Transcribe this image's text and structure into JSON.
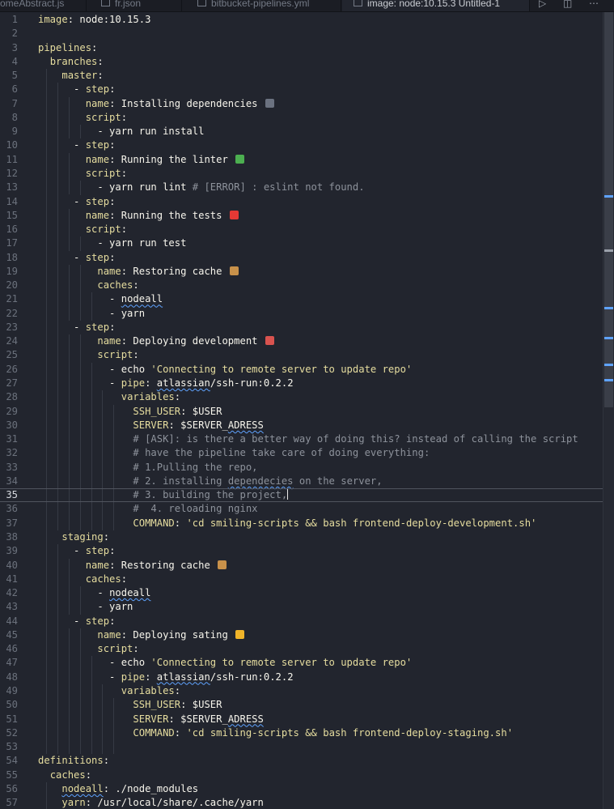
{
  "tabs": [
    {
      "label": "omeAbstract.js",
      "active": false
    },
    {
      "label": "fr.json",
      "active": false
    },
    {
      "label": "bitbucket-pipelines.yml",
      "active": false
    },
    {
      "label": "image: node:10.15.3 Untitled-1",
      "active": true
    }
  ],
  "lines": [
    {
      "n": "1",
      "segs": [
        {
          "t": "image",
          "c": "k"
        },
        {
          "t": ": node:10.15.3",
          "c": "v"
        }
      ]
    },
    {
      "n": "2",
      "segs": []
    },
    {
      "n": "3",
      "segs": [
        {
          "t": "pipelines",
          "c": "k"
        },
        {
          "t": ":",
          "c": "v"
        }
      ]
    },
    {
      "n": "4",
      "segs": [
        {
          "t": "  "
        },
        {
          "t": "branches",
          "c": "k"
        },
        {
          "t": ":",
          "c": "v"
        }
      ]
    },
    {
      "n": "5",
      "segs": [
        {
          "t": "    "
        },
        {
          "t": "master",
          "c": "k"
        },
        {
          "t": ":",
          "c": "v"
        }
      ]
    },
    {
      "n": "6",
      "segs": [
        {
          "t": "      - ",
          "c": "v"
        },
        {
          "t": "step",
          "c": "k"
        },
        {
          "t": ":",
          "c": "v"
        }
      ]
    },
    {
      "n": "7",
      "segs": [
        {
          "t": "        "
        },
        {
          "t": "name",
          "c": "k"
        },
        {
          "t": ": Installing dependencies",
          "c": "v"
        }
      ],
      "emoji": "plug"
    },
    {
      "n": "8",
      "segs": [
        {
          "t": "        "
        },
        {
          "t": "script",
          "c": "k"
        },
        {
          "t": ":",
          "c": "v"
        }
      ]
    },
    {
      "n": "9",
      "segs": [
        {
          "t": "          - yarn run install",
          "c": "v"
        }
      ]
    },
    {
      "n": "10",
      "segs": [
        {
          "t": "      - ",
          "c": "v"
        },
        {
          "t": "step",
          "c": "k"
        },
        {
          "t": ":",
          "c": "v"
        }
      ]
    },
    {
      "n": "11",
      "segs": [
        {
          "t": "        "
        },
        {
          "t": "name",
          "c": "k"
        },
        {
          "t": ": Running the linter",
          "c": "v"
        }
      ],
      "emoji": "seedling"
    },
    {
      "n": "12",
      "segs": [
        {
          "t": "        "
        },
        {
          "t": "script",
          "c": "k"
        },
        {
          "t": ":",
          "c": "v"
        }
      ]
    },
    {
      "n": "13",
      "segs": [
        {
          "t": "          - yarn run lint ",
          "c": "v"
        },
        {
          "t": "# [ERROR] : eslint not found.",
          "c": "c"
        }
      ]
    },
    {
      "n": "14",
      "segs": [
        {
          "t": "      - ",
          "c": "v"
        },
        {
          "t": "step",
          "c": "k"
        },
        {
          "t": ":",
          "c": "v"
        }
      ]
    },
    {
      "n": "15",
      "segs": [
        {
          "t": "        "
        },
        {
          "t": "name",
          "c": "k"
        },
        {
          "t": ": Running the tests",
          "c": "v"
        }
      ],
      "emoji": "siren"
    },
    {
      "n": "16",
      "segs": [
        {
          "t": "        "
        },
        {
          "t": "script",
          "c": "k"
        },
        {
          "t": ":",
          "c": "v"
        }
      ]
    },
    {
      "n": "17",
      "segs": [
        {
          "t": "          - yarn run test",
          "c": "v"
        }
      ]
    },
    {
      "n": "18",
      "segs": [
        {
          "t": "      - ",
          "c": "v"
        },
        {
          "t": "step",
          "c": "k"
        },
        {
          "t": ":",
          "c": "v"
        }
      ]
    },
    {
      "n": "19",
      "segs": [
        {
          "t": "          "
        },
        {
          "t": "name",
          "c": "k"
        },
        {
          "t": ": Restoring cache",
          "c": "v"
        }
      ],
      "emoji": "package"
    },
    {
      "n": "20",
      "segs": [
        {
          "t": "          "
        },
        {
          "t": "caches",
          "c": "k"
        },
        {
          "t": ":",
          "c": "v"
        }
      ]
    },
    {
      "n": "21",
      "segs": [
        {
          "t": "            - ",
          "c": "v"
        },
        {
          "t": "nodeall",
          "c": "v sq"
        }
      ]
    },
    {
      "n": "22",
      "segs": [
        {
          "t": "            - yarn",
          "c": "v"
        }
      ]
    },
    {
      "n": "23",
      "segs": [
        {
          "t": "      - ",
          "c": "v"
        },
        {
          "t": "step",
          "c": "k"
        },
        {
          "t": ":",
          "c": "v"
        }
      ]
    },
    {
      "n": "24",
      "segs": [
        {
          "t": "          "
        },
        {
          "t": "name",
          "c": "k"
        },
        {
          "t": ": Deploying development",
          "c": "v"
        }
      ],
      "emoji": "rocket"
    },
    {
      "n": "25",
      "segs": [
        {
          "t": "          "
        },
        {
          "t": "script",
          "c": "k"
        },
        {
          "t": ":",
          "c": "v"
        }
      ]
    },
    {
      "n": "26",
      "segs": [
        {
          "t": "            - echo ",
          "c": "v"
        },
        {
          "t": "'Connecting to remote server to update repo'",
          "c": "s"
        }
      ]
    },
    {
      "n": "27",
      "segs": [
        {
          "t": "            - ",
          "c": "v"
        },
        {
          "t": "pipe",
          "c": "k"
        },
        {
          "t": ": ",
          "c": "v"
        },
        {
          "t": "atlassian",
          "c": "v sq"
        },
        {
          "t": "/ssh-run:0.2.2",
          "c": "v"
        }
      ]
    },
    {
      "n": "28",
      "segs": [
        {
          "t": "              "
        },
        {
          "t": "variables",
          "c": "k"
        },
        {
          "t": ":",
          "c": "v"
        }
      ]
    },
    {
      "n": "29",
      "segs": [
        {
          "t": "                "
        },
        {
          "t": "SSH_USER",
          "c": "k"
        },
        {
          "t": ": $USER",
          "c": "v"
        }
      ]
    },
    {
      "n": "30",
      "segs": [
        {
          "t": "                "
        },
        {
          "t": "SERVER",
          "c": "k"
        },
        {
          "t": ": $SERVER_",
          "c": "v"
        },
        {
          "t": "ADRESS",
          "c": "v sq"
        }
      ]
    },
    {
      "n": "31",
      "segs": [
        {
          "t": "                "
        },
        {
          "t": "# [ASK]: is there a better way of doing this? instead of calling the script",
          "c": "c"
        }
      ]
    },
    {
      "n": "32",
      "segs": [
        {
          "t": "                "
        },
        {
          "t": "# have the pipeline take care of doing everything:",
          "c": "c"
        }
      ]
    },
    {
      "n": "33",
      "segs": [
        {
          "t": "                "
        },
        {
          "t": "# 1.Pulling the repo,",
          "c": "c"
        }
      ]
    },
    {
      "n": "34",
      "segs": [
        {
          "t": "                "
        },
        {
          "t": "# 2. installing ",
          "c": "c"
        },
        {
          "t": "dependecies",
          "c": "c sq"
        },
        {
          "t": " on the server,",
          "c": "c"
        }
      ]
    },
    {
      "n": "35",
      "segs": [
        {
          "t": "                "
        },
        {
          "t": "# 3. building the project,",
          "c": "c"
        }
      ],
      "current": true
    },
    {
      "n": "36",
      "segs": [
        {
          "t": "                "
        },
        {
          "t": "#  4. reloading nginx",
          "c": "c"
        }
      ]
    },
    {
      "n": "37",
      "segs": [
        {
          "t": "                "
        },
        {
          "t": "COMMAND",
          "c": "k"
        },
        {
          "t": ": ",
          "c": "v"
        },
        {
          "t": "'cd smiling-scripts && bash frontend-deploy-development.sh'",
          "c": "s"
        }
      ]
    },
    {
      "n": "38",
      "segs": [
        {
          "t": "    "
        },
        {
          "t": "staging",
          "c": "k"
        },
        {
          "t": ":",
          "c": "v"
        }
      ]
    },
    {
      "n": "39",
      "segs": [
        {
          "t": "      - ",
          "c": "v"
        },
        {
          "t": "step",
          "c": "k"
        },
        {
          "t": ":",
          "c": "v"
        }
      ]
    },
    {
      "n": "40",
      "segs": [
        {
          "t": "        "
        },
        {
          "t": "name",
          "c": "k"
        },
        {
          "t": ": Restoring cache",
          "c": "v"
        }
      ],
      "emoji": "package"
    },
    {
      "n": "41",
      "segs": [
        {
          "t": "        "
        },
        {
          "t": "caches",
          "c": "k"
        },
        {
          "t": ":",
          "c": "v"
        }
      ]
    },
    {
      "n": "42",
      "segs": [
        {
          "t": "          - ",
          "c": "v"
        },
        {
          "t": "nodeall",
          "c": "v sq"
        }
      ]
    },
    {
      "n": "43",
      "segs": [
        {
          "t": "          - yarn",
          "c": "v"
        }
      ]
    },
    {
      "n": "44",
      "segs": [
        {
          "t": "      - ",
          "c": "v"
        },
        {
          "t": "step",
          "c": "k"
        },
        {
          "t": ":",
          "c": "v"
        }
      ]
    },
    {
      "n": "45",
      "segs": [
        {
          "t": "          "
        },
        {
          "t": "name",
          "c": "k"
        },
        {
          "t": ": Deploying sating",
          "c": "v"
        }
      ],
      "emoji": "hand"
    },
    {
      "n": "46",
      "segs": [
        {
          "t": "          "
        },
        {
          "t": "script",
          "c": "k"
        },
        {
          "t": ":",
          "c": "v"
        }
      ]
    },
    {
      "n": "47",
      "segs": [
        {
          "t": "            - echo ",
          "c": "v"
        },
        {
          "t": "'Connecting to remote server to update repo'",
          "c": "s"
        }
      ]
    },
    {
      "n": "48",
      "segs": [
        {
          "t": "            - ",
          "c": "v"
        },
        {
          "t": "pipe",
          "c": "k"
        },
        {
          "t": ": ",
          "c": "v"
        },
        {
          "t": "atlassian",
          "c": "v sq"
        },
        {
          "t": "/ssh-run:0.2.2",
          "c": "v"
        }
      ]
    },
    {
      "n": "49",
      "segs": [
        {
          "t": "              "
        },
        {
          "t": "variables",
          "c": "k"
        },
        {
          "t": ":",
          "c": "v"
        }
      ]
    },
    {
      "n": "50",
      "segs": [
        {
          "t": "                "
        },
        {
          "t": "SSH_USER",
          "c": "k"
        },
        {
          "t": ": $USER",
          "c": "v"
        }
      ]
    },
    {
      "n": "51",
      "segs": [
        {
          "t": "                "
        },
        {
          "t": "SERVER",
          "c": "k"
        },
        {
          "t": ": $SERVER_",
          "c": "v"
        },
        {
          "t": "ADRESS",
          "c": "v sq"
        }
      ]
    },
    {
      "n": "52",
      "segs": [
        {
          "t": "                "
        },
        {
          "t": "COMMAND",
          "c": "k"
        },
        {
          "t": ": ",
          "c": "v"
        },
        {
          "t": "'cd smiling-scripts && bash frontend-deploy-staging.sh'",
          "c": "s"
        }
      ]
    },
    {
      "n": "53",
      "segs": []
    },
    {
      "n": "54",
      "segs": [
        {
          "t": "definitions",
          "c": "k"
        },
        {
          "t": ":",
          "c": "v"
        }
      ]
    },
    {
      "n": "55",
      "segs": [
        {
          "t": "  "
        },
        {
          "t": "caches",
          "c": "k"
        },
        {
          "t": ":",
          "c": "v"
        }
      ]
    },
    {
      "n": "56",
      "segs": [
        {
          "t": "    "
        },
        {
          "t": "nodeall",
          "c": "k sq"
        },
        {
          "t": ": ./node_modules",
          "c": "v"
        }
      ]
    },
    {
      "n": "57",
      "segs": [
        {
          "t": "    "
        },
        {
          "t": "yarn",
          "c": "k"
        },
        {
          "t": ": /usr/local/share/.cache/yarn",
          "c": "v"
        }
      ]
    }
  ],
  "emojis": {
    "plug": "#6b7280",
    "seedling": "#4caf50",
    "siren": "#e53935",
    "package": "#c8914a",
    "rocket": "#d9534f",
    "hand": "#f0b429"
  },
  "colors": {
    "background": "#22252e",
    "key": "#e6dd9f",
    "value": "#f7f5ec",
    "comment": "#8d929b",
    "line_number": "#6b717c",
    "squiggle": "#5fa3ff"
  }
}
